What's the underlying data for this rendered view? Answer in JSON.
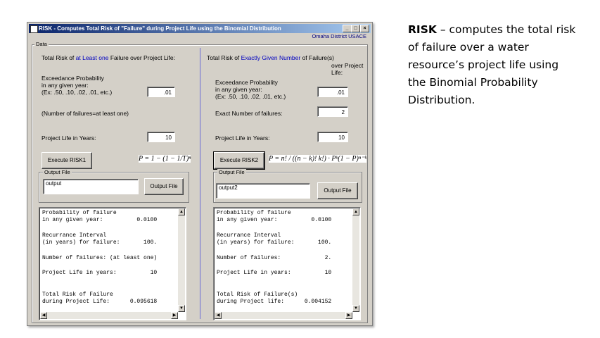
{
  "window": {
    "title": "RISK - Computes Total Risk of \"Failure\" during Project Life using the Binomial Distribution",
    "subtitle": "Omaha District USACE",
    "group_label": "Data",
    "minimize": "_",
    "maximize": "□",
    "close": "×"
  },
  "left": {
    "heading_prefix": "Total Risk of ",
    "heading_highlight": "at Least one",
    "heading_suffix": " Failure over Project Life:",
    "exceed_line1": "Exceedance Probability",
    "exceed_line2": "in any given year:",
    "exceed_line3": "(Ex: .50, .10, .02, .01, etc.)",
    "exceed_value": ".01",
    "failures_note": "(Number of failures=at least one)",
    "life_label": "Project Life in Years:",
    "life_value": "10",
    "execute_label": "Execute RISK1",
    "formula": "P = 1 − (1 − 1/T)ⁿ",
    "output_group": "Output File",
    "output_value": "output",
    "output_button": "Output File",
    "results": [
      "Probability of failure",
      "in any given year:          0.0100",
      "Recurrance Interval",
      "(in years) for failure:       100.",
      "Number of failures: (at least one)",
      "Project Life in years:          10",
      "Total Risk of Failure",
      "during Project Life:      0.095618"
    ]
  },
  "right": {
    "heading_prefix": "Total Risk of ",
    "heading_highlight": "Exactly Given Number",
    "heading_suffix_l1": " of Failure(s)",
    "heading_suffix_l2": "over Project",
    "heading_suffix_l3": "Life:",
    "exceed_line1": "Exceedance Probability",
    "exceed_line2": "in any given year:",
    "exceed_line3": "(Ex: .50, .10, .02, .01, etc.)",
    "exceed_value": ".01",
    "exact_label": "Exact Number of failures:",
    "exact_value": "2",
    "life_label": "Project Life in Years:",
    "life_value": "10",
    "execute_label": "Execute RISK2",
    "formula": "P = n! / ((n − k)! k!) · Pᵏ(1 − P)ⁿ⁻ᵏ",
    "output_group": "Output File",
    "output_value": "output2",
    "output_button": "Output File",
    "results": [
      "Probability of failure",
      "in any given year:          0.0100",
      "Recurrance Interval",
      "(in years) for failure:       100.",
      "Number of failures:             2.",
      "Project Life in years:          10",
      "Total Risk of Failure(s)",
      "during Project life:      0.004152"
    ]
  },
  "description": {
    "title": "RISK",
    "text": " – computes the total risk of failure over a water resource’s project life using the Binomial Probability Distribution."
  }
}
